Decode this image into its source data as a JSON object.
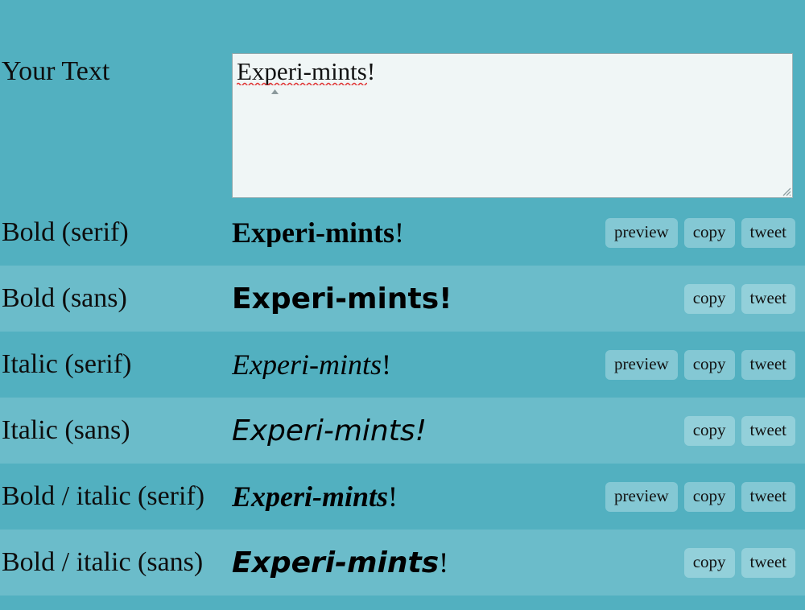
{
  "input": {
    "label": "Your Text",
    "value": "Experi-mints!",
    "spellchecked_part": "Experi-mints",
    "trailing_part": "!",
    "placeholder": ""
  },
  "colors": {
    "page_background": "#52b0c0",
    "row_dark": "#52b0c0",
    "row_light": "#6bbcca",
    "button_background": "#84c8d4",
    "button_background_light_row": "#93d0da",
    "textarea_background": "#f0f6f6",
    "textarea_border": "#9fb5b8",
    "text": "#0d0d0d",
    "spellcheck_underline": "#e03030"
  },
  "buttons": {
    "preview": "preview",
    "copy": "copy",
    "tweet": "tweet"
  },
  "rows": [
    {
      "label": "Bold (serif)",
      "sample_core": "Experi-mints",
      "sample_tail": "!",
      "variant": "v-bold-serif",
      "shade": "dark",
      "actions": [
        "preview",
        "copy",
        "tweet"
      ]
    },
    {
      "label": "Bold (sans)",
      "sample_core": "Experi-mints",
      "sample_tail": "!",
      "variant": "v-bold-sans",
      "shade": "light",
      "actions": [
        "copy",
        "tweet"
      ]
    },
    {
      "label": "Italic (serif)",
      "sample_core": "Experi-mints",
      "sample_tail": "!",
      "variant": "v-ital-serif",
      "shade": "dark",
      "actions": [
        "preview",
        "copy",
        "tweet"
      ]
    },
    {
      "label": "Italic (sans)",
      "sample_core": "Experi-mints",
      "sample_tail": "!",
      "variant": "v-ital-sans",
      "shade": "light",
      "actions": [
        "copy",
        "tweet"
      ]
    },
    {
      "label": "Bold / italic (serif)",
      "sample_core": "Experi-mints",
      "sample_tail": "!",
      "variant": "v-bi-serif",
      "shade": "dark",
      "actions": [
        "preview",
        "copy",
        "tweet"
      ]
    },
    {
      "label": "Bold / italic (sans)",
      "sample_core": "Experi-mints",
      "sample_tail": "!",
      "variant": "v-bi-sans",
      "shade": "light",
      "actions": [
        "copy",
        "tweet"
      ]
    }
  ]
}
